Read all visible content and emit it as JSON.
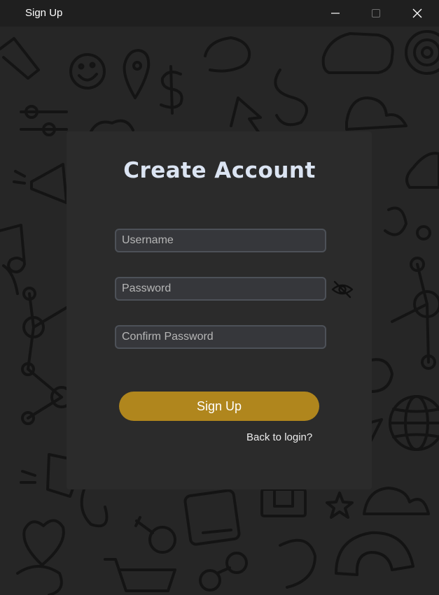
{
  "window": {
    "title": "Sign Up"
  },
  "form": {
    "heading": "Create Account",
    "username_placeholder": "Username",
    "password_placeholder": "Password",
    "confirm_placeholder": "Confirm Password",
    "signup_label": "Sign Up",
    "back_label": "Back to login?"
  },
  "colors": {
    "accent": "#b0861d",
    "card": "#2b2b2b",
    "heading": "#dbe4f2"
  }
}
